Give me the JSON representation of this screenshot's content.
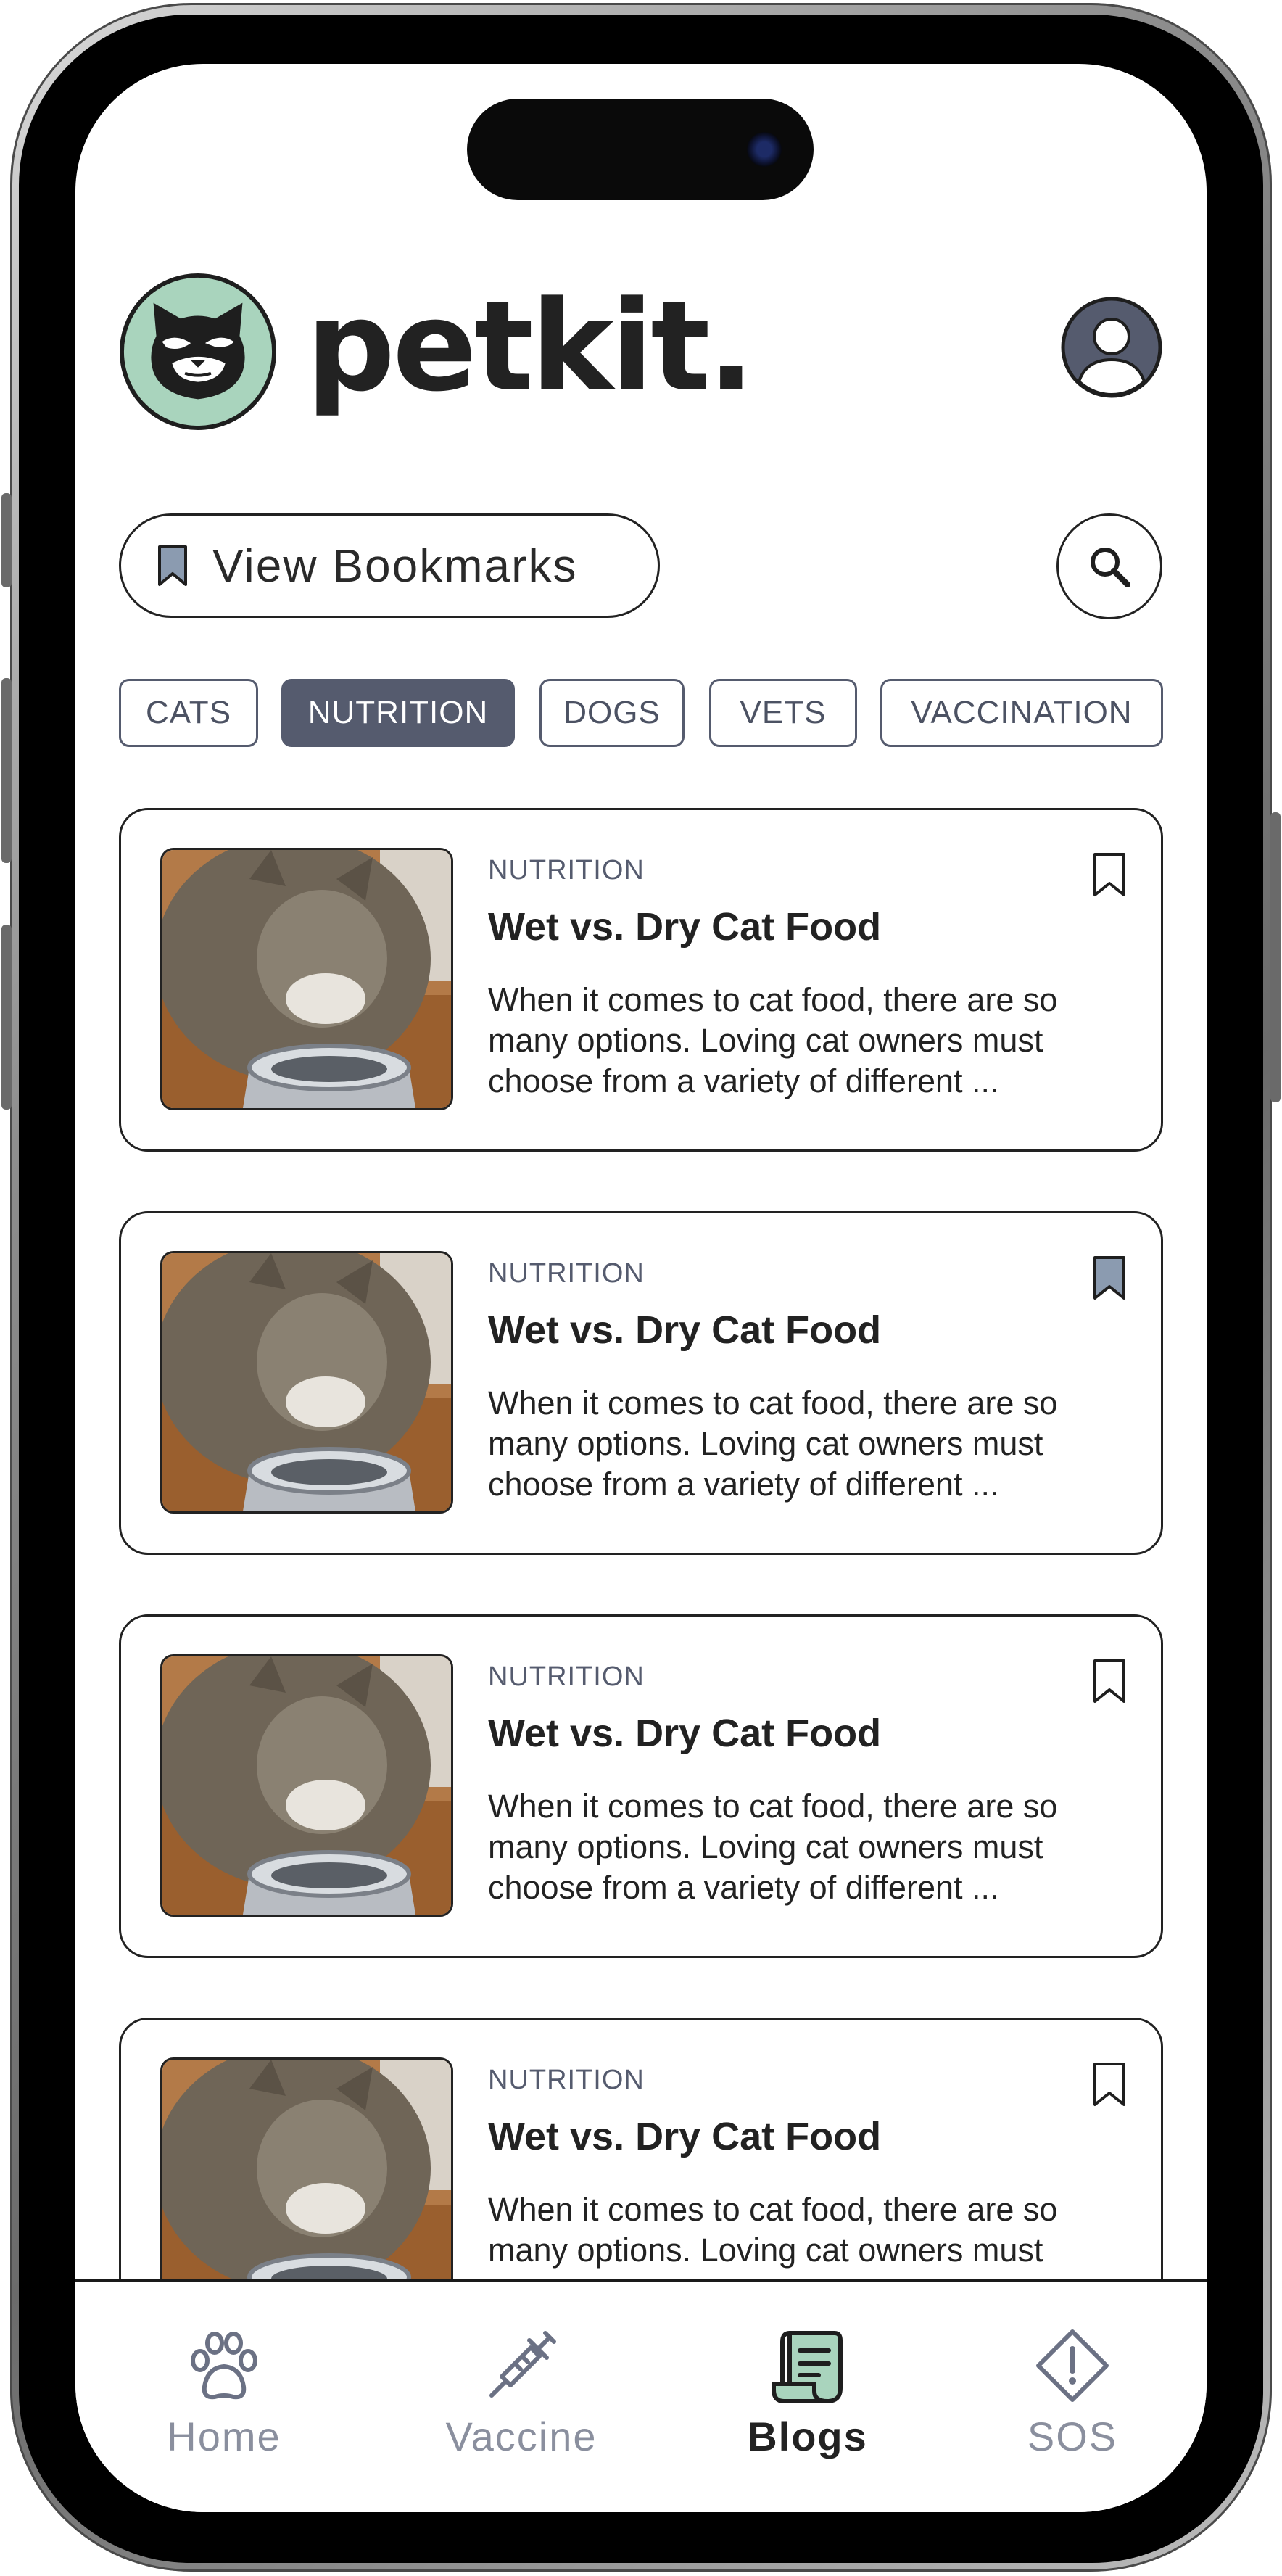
{
  "app": {
    "brand": "petkit."
  },
  "controls": {
    "bookmarks_label": "View Bookmarks"
  },
  "filters": [
    {
      "label": "CATS",
      "active": false
    },
    {
      "label": "NUTRITION",
      "active": true
    },
    {
      "label": "DOGS",
      "active": false
    },
    {
      "label": "VETS",
      "active": false
    },
    {
      "label": "VACCINATION",
      "active": false
    }
  ],
  "articles": [
    {
      "category": "NUTRITION",
      "title": "Wet vs. Dry Cat Food",
      "excerpt": "When it comes to cat food, there are so many options. Loving cat owners must choose from a variety of different ...",
      "bookmarked": false
    },
    {
      "category": "NUTRITION",
      "title": "Wet vs. Dry Cat Food",
      "excerpt": "When it comes to cat food, there are so many options. Loving cat owners must choose from a variety of different ...",
      "bookmarked": true
    },
    {
      "category": "NUTRITION",
      "title": "Wet vs. Dry Cat Food",
      "excerpt": "When it comes to cat food, there are so many options. Loving cat owners must choose from a variety of different ...",
      "bookmarked": false
    },
    {
      "category": "NUTRITION",
      "title": "Wet vs. Dry Cat Food",
      "excerpt": "When it comes to cat food, there are so many options. Loving cat owners must",
      "bookmarked": false
    }
  ],
  "nav": [
    {
      "label": "Home",
      "icon": "paw-icon",
      "active": false
    },
    {
      "label": "Vaccine",
      "icon": "syringe-icon",
      "active": false
    },
    {
      "label": "Blogs",
      "icon": "scroll-icon",
      "active": true
    },
    {
      "label": "SOS",
      "icon": "warning-icon",
      "active": false
    }
  ],
  "colors": {
    "accent": "#555b6e",
    "brand_green": "#a9d4bd",
    "bookmark_fill": "#8b9bb0",
    "text": "#222222"
  }
}
